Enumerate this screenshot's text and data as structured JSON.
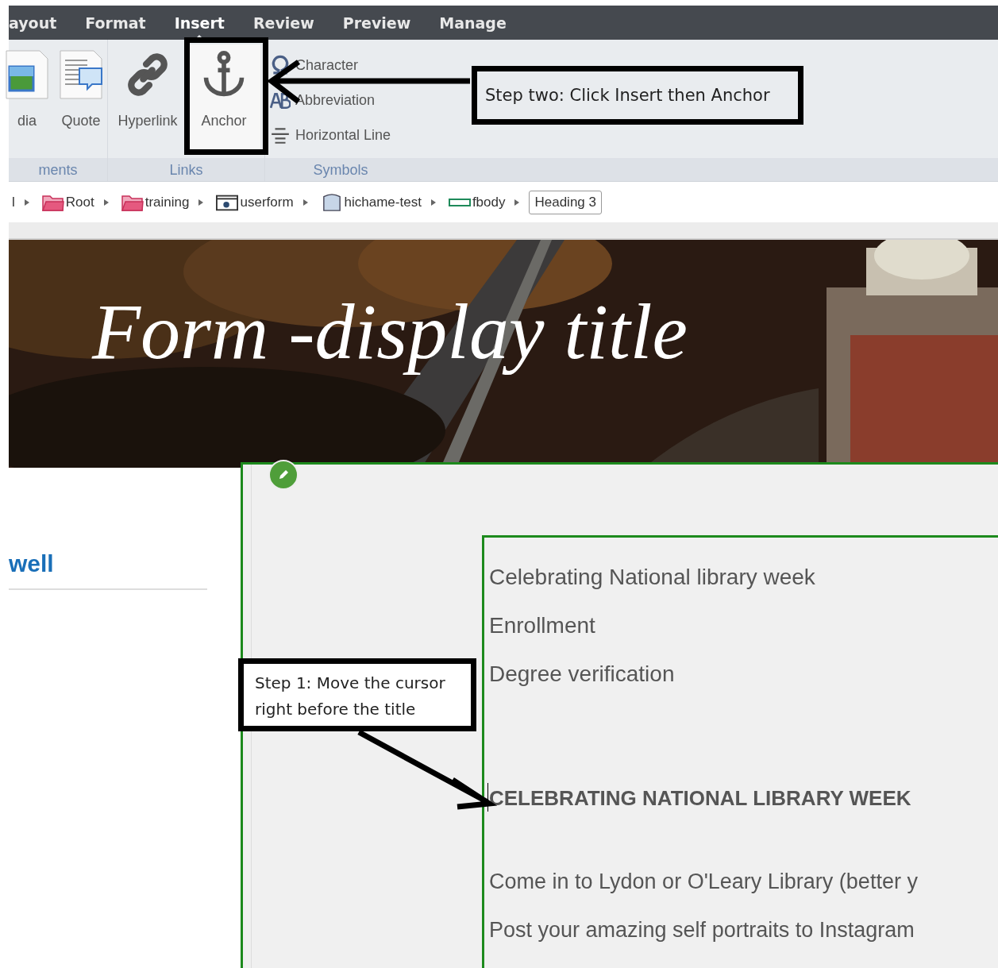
{
  "menu": {
    "tabs": [
      {
        "label": "ayout",
        "selected": false
      },
      {
        "label": "Format",
        "selected": false
      },
      {
        "label": "Insert",
        "selected": true
      },
      {
        "label": "Review",
        "selected": false
      },
      {
        "label": "Preview",
        "selected": false
      },
      {
        "label": "Manage",
        "selected": false
      }
    ]
  },
  "ribbon": {
    "groups": [
      {
        "label": "ments",
        "items": [
          {
            "label": "dia",
            "kind": "media",
            "selected": false
          },
          {
            "label": "Quote",
            "kind": "quote",
            "selected": false
          }
        ]
      },
      {
        "label": "Links",
        "items": [
          {
            "label": "Hyperlink",
            "kind": "link",
            "selected": false
          },
          {
            "label": "Anchor",
            "kind": "anchor",
            "selected": true
          }
        ]
      },
      {
        "label": "Symbols",
        "items": [
          {
            "label": "Character",
            "kind": "omega",
            "selected": false
          },
          {
            "label": "Abbreviation",
            "kind": "abbr",
            "selected": false
          },
          {
            "label": "Horizontal Line",
            "kind": "hline",
            "selected": false
          }
        ]
      }
    ]
  },
  "breadcrumb": {
    "items": [
      {
        "label": "l",
        "kind": "plain"
      },
      {
        "label": "Root",
        "kind": "folder"
      },
      {
        "label": "training",
        "kind": "folder"
      },
      {
        "label": "userform",
        "kind": "form"
      },
      {
        "label": "hichame-test",
        "kind": "database"
      },
      {
        "label": "fbody",
        "kind": "field"
      },
      {
        "label": "Heading 3",
        "kind": "tag"
      }
    ]
  },
  "hero": {
    "title": "Form -display title"
  },
  "sidebar": {
    "link": "well"
  },
  "content": {
    "menu_items": [
      "Celebrating National library week",
      "Enrollment",
      "Degree verification"
    ],
    "heading": "CELEBRATING NATIONAL LIBRARY WEEK",
    "paragraphs": [
      "Come in to Lydon or O'Leary Library (better y",
      "Post your amazing self portraits to Instagram"
    ]
  },
  "annotations": [
    {
      "text": "Step two: Click Insert then Anchor"
    },
    {
      "text": "Step 1: Move the cursor right before the title"
    }
  ]
}
